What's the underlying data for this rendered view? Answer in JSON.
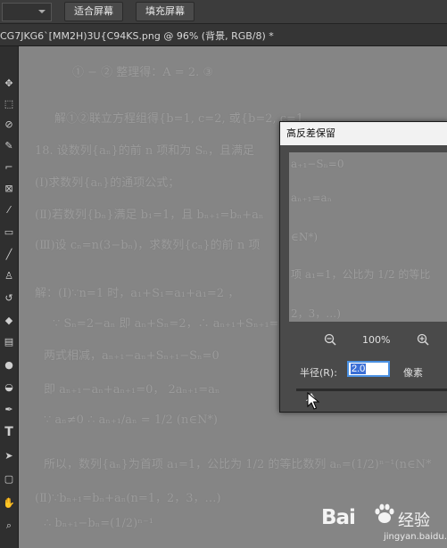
{
  "options_bar": {
    "fit_screen_label": "适合屏幕",
    "fill_screen_label": "填充屏幕"
  },
  "document_tab": {
    "title": "CG7JKG6`[MM2H)3U{C94KS.png @ 96% (背景, RGB/8) *"
  },
  "toolbar": {
    "tools": [
      "move-icon",
      "marquee-icon",
      "lasso-icon",
      "quick-select-icon",
      "crop-icon",
      "frame-icon",
      "eyedropper-icon",
      "healing-icon",
      "brush-icon",
      "stamp-icon",
      "history-brush-icon",
      "eraser-icon",
      "gradient-icon",
      "blur-icon",
      "dodge-icon",
      "pen-icon",
      "type-icon",
      "path-select-icon",
      "rectangle-icon",
      "hand-icon",
      "zoom-icon"
    ],
    "type_glyph": "T"
  },
  "canvas": {
    "lines": [
      "① − ②  整理得：A = 2.        ③",
      "解①②联立方程组得{b=1, c=2,   或{b=2, c=1,",
      "18. 设数列{aₙ}的前 n 项和为 Sₙ，且满足",
      "(Ⅰ)求数列{aₙ}的通项公式；",
      "(Ⅱ)若数列{bₙ}满足 b₁=1，且 bₙ₊₁=bₙ+aₙ",
      "(Ⅲ)设 cₙ=n(3−bₙ)，求数列{cₙ}的前 n 项",
      "解：(Ⅰ)∵n=1 时，a₁+S₁=a₁+a₁=2   ，",
      "∵ Sₙ=2−aₙ 即 aₙ+Sₙ=2，∴ aₙ₊₁+Sₙ₊₁=2",
      "两式相减，aₙ₊₁−aₙ+Sₙ₊₁−Sₙ=0",
      "即 aₙ₊₁−aₙ+aₙ₊₁=0，   2aₙ₊₁=aₙ",
      "∵ aₙ≠0  ∴ aₙ₊₁/aₙ = 1/2 (n∈N*)",
      "所以，数列{aₙ}为首项 a₁=1，公比为 1/2 的等比数列 aₙ=(1/2)ⁿ⁻¹(n∈N*",
      "(Ⅱ)∵bₙ₊₁=bₙ+aₙ(n=1，2，3，…)",
      "∴ bₙ₊₁−bₙ=(1/2)ⁿ⁻¹"
    ]
  },
  "dialog": {
    "title": "高反差保留",
    "preview_lines": [
      "a₊₁−Sₙ=0",
      "aₙ₊₁=aₙ",
      "∈N*)",
      "项 a₁=1，公比为 1/2 的等比",
      "2，3，…)"
    ],
    "zoom_percent": "100%",
    "radius_label": "半径(R):",
    "radius_value": "2.0",
    "unit_label": "像素"
  },
  "watermark": {
    "brand": "Bai",
    "brand_cn": "经验",
    "url": "jingyan.baidu.com"
  }
}
